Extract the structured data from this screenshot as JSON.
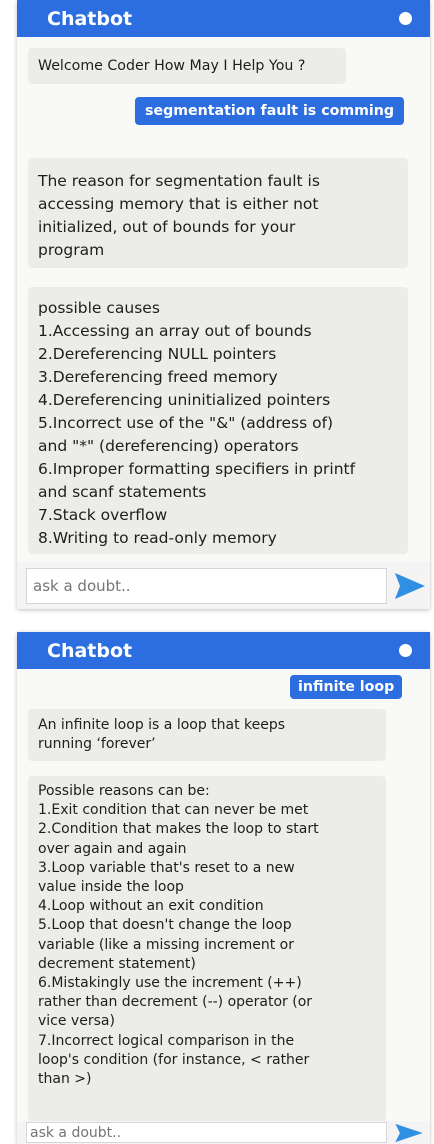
{
  "panel1": {
    "header": {
      "title": "Chatbot"
    },
    "messages": {
      "welcome": "Welcome Coder How May I Help You ?",
      "user": "segmentation fault is comming",
      "reason": "The reason for segmentation fault is\naccessing memory that is either not\ninitialized, out of bounds for your\nprogram",
      "causes": "possible causes\n1.Accessing an array out of bounds\n2.Dereferencing NULL pointers\n3.Dereferencing freed memory\n4.Dereferencing uninitialized pointers\n5.Incorrect use of the \"&\" (address of)\nand \"*\" (dereferencing) operators\n6.Improper formatting specifiers in printf\nand scanf statements\n7.Stack overflow\n8.Writing to read-only memory"
    },
    "input": {
      "placeholder": "ask a doubt.."
    }
  },
  "panel2": {
    "header": {
      "title": "Chatbot"
    },
    "messages": {
      "user": "infinite loop",
      "definition": "An infinite loop is a loop that keeps\nrunning ‘forever’",
      "reasons": "Possible reasons can be:\n1.Exit condition that can never be met\n2.Condition that makes the loop to start\nover again and again\n3.Loop variable that's reset to a new\nvalue inside the loop\n4.Loop without an exit condition\n5.Loop that doesn't change the loop\nvariable (like a missing increment or\ndecrement statement)\n6.Mistakingly use the increment (++)\nrather than decrement (--) operator (or\nvice versa)\n7.Incorrect logical comparison in the\nloop's condition (for instance, < rather\nthan >)"
    },
    "input": {
      "placeholder": "ask a doubt.."
    }
  },
  "colors": {
    "header": "#2c6de0",
    "user_bubble": "#2c6de0",
    "bot_bubble": "#ecece8",
    "send_icon": "#2f8fe3"
  },
  "icons": {
    "status": "status-dot-icon",
    "send": "send-icon"
  }
}
